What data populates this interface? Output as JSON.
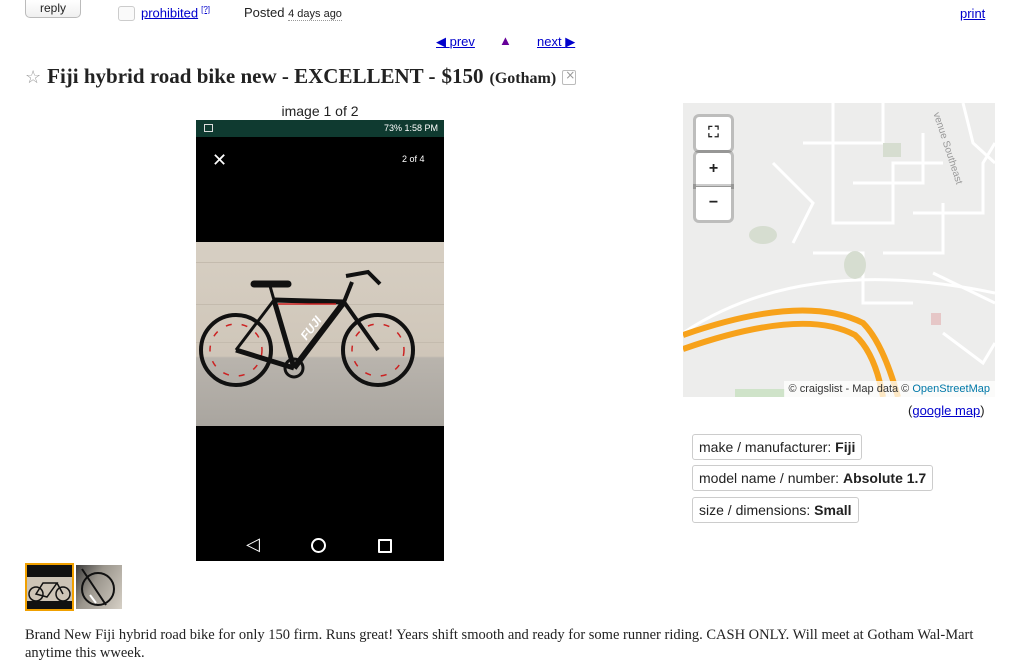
{
  "topbar": {
    "reply_label": "reply",
    "prohibited_label": "prohibited",
    "prohibited_sup": "[?]",
    "posted_label": "Posted",
    "posted_ago": "4 days ago",
    "print_label": "print"
  },
  "nav": {
    "prev_label": "prev",
    "up_label": "▲",
    "next_label": "next"
  },
  "title": {
    "star": "☆",
    "text": "Fiji hybrid road bike new - EXCELLENT -",
    "price": "$150",
    "location": "(Gotham)"
  },
  "gallery": {
    "counter": "image 1 of 2",
    "phone_battery": "73%",
    "phone_time": "1:58 PM",
    "phone_count": "2 of 4",
    "bike_brand_text": "FUJI"
  },
  "map": {
    "attribution_prefix": "© craigslist - Map data ©",
    "attribution_link": "OpenStreetMap",
    "road_label": "venue Southeast",
    "google_prefix": "(",
    "google_link": "google map",
    "google_suffix": ")"
  },
  "attributes": [
    {
      "label": "make / manufacturer:",
      "value": "Fiji"
    },
    {
      "label": "model name / number:",
      "value": "Absolute 1.7"
    },
    {
      "label": "size / dimensions:",
      "value": "Small"
    }
  ],
  "description": "Brand New Fiji hybrid road bike for only 150 firm. Runs great! Years shift smooth and ready for some runner riding. CASH ONLY. Will meet at Gotham Wal-Mart anytime this wweek.",
  "colors": {
    "link": "#0000cc",
    "thumb_selected": "#f0a000",
    "map_road": "#f7a21b"
  }
}
